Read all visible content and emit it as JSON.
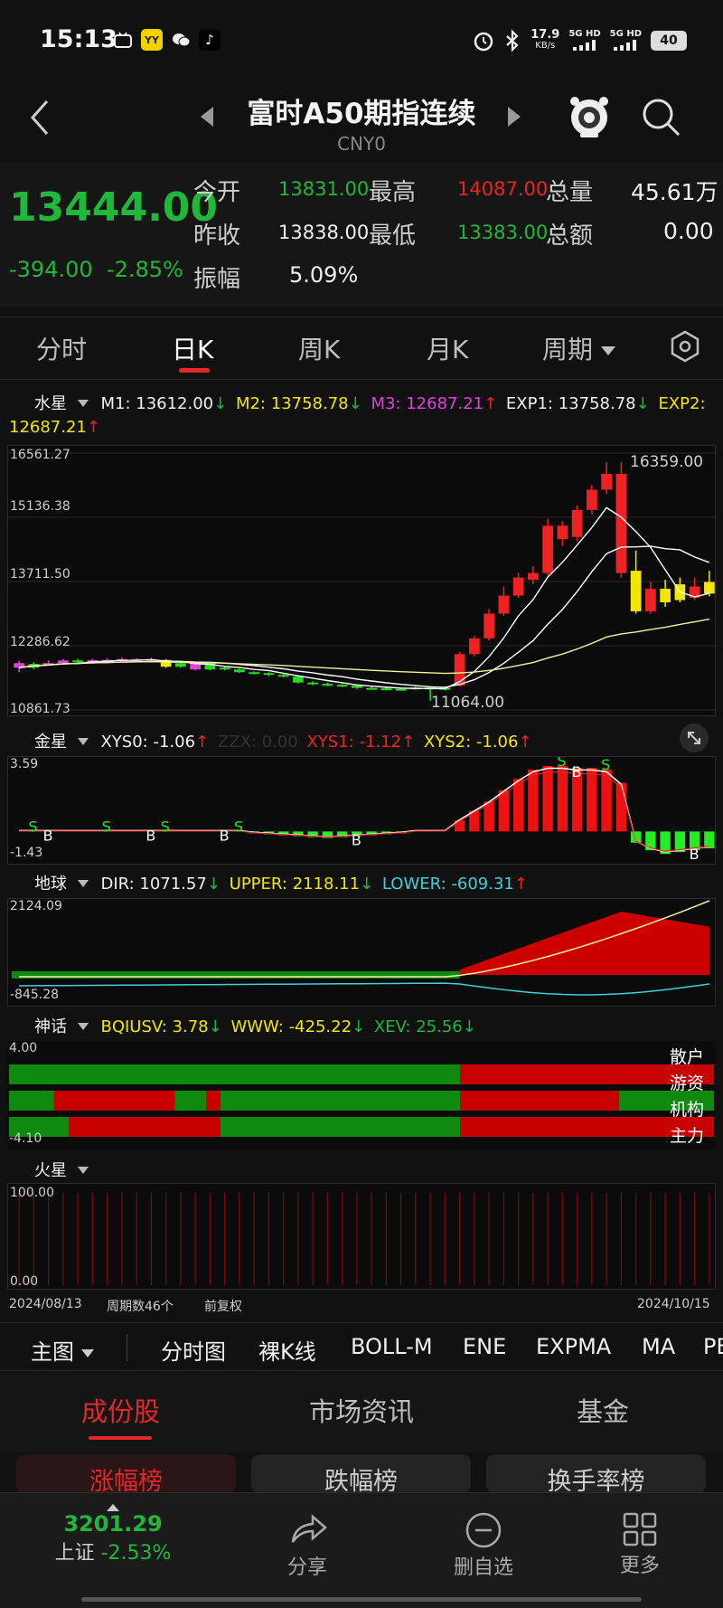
{
  "status_bar": {
    "time": "15:13",
    "net_speed": "17.9",
    "net_unit": "KB/s",
    "sim1": "5G HD",
    "sim2": "5G HD",
    "battery": "40"
  },
  "header": {
    "title": "富时A50期指连续",
    "subtitle": "CNY0",
    "back_icon": "chevron-left-icon",
    "prev_icon": "triangle-left-icon",
    "next_icon": "triangle-right-icon",
    "mascot_icon": "mascot-icon",
    "search_icon": "search-icon"
  },
  "quote": {
    "price": "13444.00",
    "change": "-394.00",
    "change_pct": "-2.85%",
    "open_label": "今开",
    "open": "13831.00",
    "high_label": "最高",
    "high": "14087.00",
    "volume_label": "总量",
    "volume": "45.61万",
    "prev_close_label": "昨收",
    "prev_close": "13838.00",
    "low_label": "最低",
    "low": "13383.00",
    "amount_label": "总额",
    "amount": "0.00",
    "amplitude_label": "振幅",
    "amplitude": "5.09%"
  },
  "tabs": [
    "分时",
    "日K",
    "周K",
    "月K",
    "周期"
  ],
  "main_chart": {
    "name": "水星",
    "m1": "M1: 13612.00",
    "m1_arrow": "↓",
    "m2": "M2: 13758.78",
    "m2_arrow": "↓",
    "m3": "M3: 12687.21",
    "m3_arrow": "↑",
    "exp1": "EXP1: 13758.78",
    "exp1_arrow": "↓",
    "exp2_label": "EXP2:",
    "exp2_value": "12687.21",
    "exp2_arrow": "↑",
    "y_labels": [
      "16561.27",
      "15136.38",
      "13711.50",
      "12286.62",
      "10861.73"
    ],
    "max_label": "16359.00",
    "min_label": "11064.00"
  },
  "chart_data": {
    "type": "candlestick",
    "x_start": "2024/08/13",
    "x_end": "2024/10/15",
    "ylim": [
      10861.73,
      16561.27
    ],
    "candles": [
      {
        "o": 11900,
        "c": 11800,
        "h": 11950,
        "l": 11700,
        "color": "magenta"
      },
      {
        "o": 11800,
        "c": 11880,
        "h": 11920,
        "l": 11760,
        "color": "green"
      },
      {
        "o": 11880,
        "c": 11900,
        "h": 11960,
        "l": 11840,
        "color": "magenta"
      },
      {
        "o": 11900,
        "c": 11960,
        "h": 11990,
        "l": 11880,
        "color": "magenta"
      },
      {
        "o": 11960,
        "c": 11930,
        "h": 12000,
        "l": 11900,
        "color": "green"
      },
      {
        "o": 11930,
        "c": 11970,
        "h": 12000,
        "l": 11910,
        "color": "magenta"
      },
      {
        "o": 11970,
        "c": 11960,
        "h": 12010,
        "l": 11930,
        "color": "magenta"
      },
      {
        "o": 11960,
        "c": 11990,
        "h": 12020,
        "l": 11940,
        "color": "magenta"
      },
      {
        "o": 11990,
        "c": 11970,
        "h": 12010,
        "l": 11950,
        "color": "magenta"
      },
      {
        "o": 11970,
        "c": 11990,
        "h": 12020,
        "l": 11950,
        "color": "magenta"
      },
      {
        "o": 11970,
        "c": 11820,
        "h": 11990,
        "l": 11800,
        "color": "yellow"
      },
      {
        "o": 11820,
        "c": 11900,
        "h": 11920,
        "l": 11800,
        "color": "green"
      },
      {
        "o": 11900,
        "c": 11760,
        "h": 11920,
        "l": 11740,
        "color": "magenta"
      },
      {
        "o": 11760,
        "c": 11900,
        "h": 11910,
        "l": 11740,
        "color": "green"
      },
      {
        "o": 11800,
        "c": 11760,
        "h": 11830,
        "l": 11740,
        "color": "green"
      },
      {
        "o": 11760,
        "c": 11700,
        "h": 11780,
        "l": 11680,
        "color": "green"
      },
      {
        "o": 11700,
        "c": 11680,
        "h": 11720,
        "l": 11650,
        "color": "green"
      },
      {
        "o": 11680,
        "c": 11640,
        "h": 11700,
        "l": 11610,
        "color": "green"
      },
      {
        "o": 11640,
        "c": 11600,
        "h": 11660,
        "l": 11580,
        "color": "green"
      },
      {
        "o": 11600,
        "c": 11470,
        "h": 11620,
        "l": 11450,
        "color": "green"
      },
      {
        "o": 11470,
        "c": 11440,
        "h": 11500,
        "l": 11410,
        "color": "green"
      },
      {
        "o": 11440,
        "c": 11420,
        "h": 11470,
        "l": 11390,
        "color": "green"
      },
      {
        "o": 11420,
        "c": 11400,
        "h": 11440,
        "l": 11370,
        "color": "green"
      },
      {
        "o": 11400,
        "c": 11350,
        "h": 11420,
        "l": 11330,
        "color": "green"
      },
      {
        "o": 11350,
        "c": 11340,
        "h": 11380,
        "l": 11310,
        "color": "green"
      },
      {
        "o": 11340,
        "c": 11320,
        "h": 11370,
        "l": 11300,
        "color": "green"
      },
      {
        "o": 11320,
        "c": 11330,
        "h": 11360,
        "l": 11300,
        "color": "green"
      },
      {
        "o": 11330,
        "c": 11360,
        "h": 11380,
        "l": 11310,
        "color": "green"
      },
      {
        "o": 11360,
        "c": 11320,
        "h": 11390,
        "l": 11064,
        "color": "green"
      },
      {
        "o": 11320,
        "c": 11350,
        "h": 11380,
        "l": 11290,
        "color": "green"
      },
      {
        "o": 11400,
        "c": 12100,
        "h": 12150,
        "l": 11380,
        "color": "red"
      },
      {
        "o": 12100,
        "c": 12450,
        "h": 12500,
        "l": 12050,
        "color": "red"
      },
      {
        "o": 12450,
        "c": 13000,
        "h": 13100,
        "l": 12400,
        "color": "red"
      },
      {
        "o": 13000,
        "c": 13400,
        "h": 13600,
        "l": 12950,
        "color": "red"
      },
      {
        "o": 13400,
        "c": 13800,
        "h": 13900,
        "l": 13350,
        "color": "red"
      },
      {
        "o": 13750,
        "c": 13900,
        "h": 14050,
        "l": 13650,
        "color": "red"
      },
      {
        "o": 13900,
        "c": 14950,
        "h": 15100,
        "l": 13850,
        "color": "red"
      },
      {
        "o": 14950,
        "c": 14650,
        "h": 15050,
        "l": 14500,
        "color": "red"
      },
      {
        "o": 14700,
        "c": 15300,
        "h": 15400,
        "l": 14600,
        "color": "red"
      },
      {
        "o": 15300,
        "c": 15750,
        "h": 15850,
        "l": 15200,
        "color": "red"
      },
      {
        "o": 15750,
        "c": 16100,
        "h": 16359,
        "l": 15650,
        "color": "red"
      },
      {
        "o": 16100,
        "c": 13900,
        "h": 16359,
        "l": 13800,
        "color": "red"
      },
      {
        "o": 13950,
        "c": 13050,
        "h": 14400,
        "l": 13000,
        "color": "yellow"
      },
      {
        "o": 13050,
        "c": 13550,
        "h": 13700,
        "l": 13000,
        "color": "red"
      },
      {
        "o": 13550,
        "c": 13250,
        "h": 13750,
        "l": 13150,
        "color": "yellow"
      },
      {
        "o": 13300,
        "c": 13650,
        "h": 13800,
        "l": 13250,
        "color": "yellow"
      },
      {
        "o": 13600,
        "c": 13350,
        "h": 13800,
        "l": 13300,
        "color": "red"
      },
      {
        "o": 13700,
        "c": 13444,
        "h": 13950,
        "l": 13383,
        "color": "yellow"
      }
    ]
  },
  "jinxing": {
    "name": "金星",
    "xys0": "XYS0: -1.06",
    "xys0_arrow": "↑",
    "zzx": "ZZX: 0.00",
    "xys1": "XYS1: -1.12",
    "xys1_arrow": "↑",
    "xys2": "XYS2: -1.06",
    "xys2_arrow": "↑",
    "y_top": "3.59",
    "y_bottom": "-1.43",
    "bars": [
      0,
      0,
      0,
      0,
      0,
      0,
      0,
      0,
      0,
      0,
      0,
      0,
      0,
      0,
      0,
      0,
      -0.1,
      -0.15,
      -0.2,
      -0.25,
      -0.3,
      -0.35,
      -0.3,
      -0.25,
      -0.2,
      -0.15,
      -0.1,
      0,
      0,
      0,
      0.6,
      1.1,
      1.6,
      2.2,
      2.8,
      3.3,
      3.5,
      3.5,
      3.4,
      3.4,
      3.3,
      2.6,
      -0.6,
      -1.0,
      -1.2,
      -1.1,
      -1.0,
      -0.9
    ],
    "markers": [
      "S",
      "B",
      "S",
      "B",
      "S",
      "B",
      "S",
      "B",
      "S",
      "B",
      "S",
      "B"
    ]
  },
  "diqiu": {
    "name": "地球",
    "dir": "DIR: 1071.57",
    "dir_arrow": "↓",
    "upper": "UPPER: 2118.11",
    "upper_arrow": "↓",
    "lower": "LOWER: -609.31",
    "lower_arrow": "↑",
    "y_top": "2124.09",
    "y_bottom": "-845.28"
  },
  "shenhua": {
    "name": "神话",
    "bq": "BQIUSV: 3.78",
    "bq_arrow": "↓",
    "www": "WWW: -425.22",
    "www_arrow": "↓",
    "xev": "XEV: 25.56",
    "xev_arrow": "↓",
    "y_top": "4.00",
    "y_bottom": "-4.10",
    "row_labels": [
      "散户",
      "游资",
      "机构",
      "主力"
    ]
  },
  "huoxing": {
    "name": "火星",
    "y_top": "100.00",
    "y_bottom": "0.00"
  },
  "footer_axis": {
    "start": "2024/08/13",
    "periods": "周期数46个",
    "adjust": "前复权",
    "end": "2024/10/15"
  },
  "toolbar": [
    "主图",
    "分时图",
    "裸K线",
    "BOLL-M",
    "ENE",
    "EXPMA",
    "MA",
    "PE"
  ],
  "sub_tabs": [
    "成份股",
    "市场资讯",
    "基金"
  ],
  "rank_pills": [
    "涨幅榜",
    "跌幅榜",
    "换手率榜"
  ],
  "navbar": {
    "index_value": "3201.29",
    "index_name": "上证",
    "index_change": "-2.53%",
    "share": "分享",
    "delete": "删自选",
    "more": "更多"
  },
  "colors": {
    "up": "#ee2222",
    "down": "#1fb83a",
    "accent": "#e5262b",
    "yellow": "#f3e600",
    "magenta": "#e040e0"
  }
}
